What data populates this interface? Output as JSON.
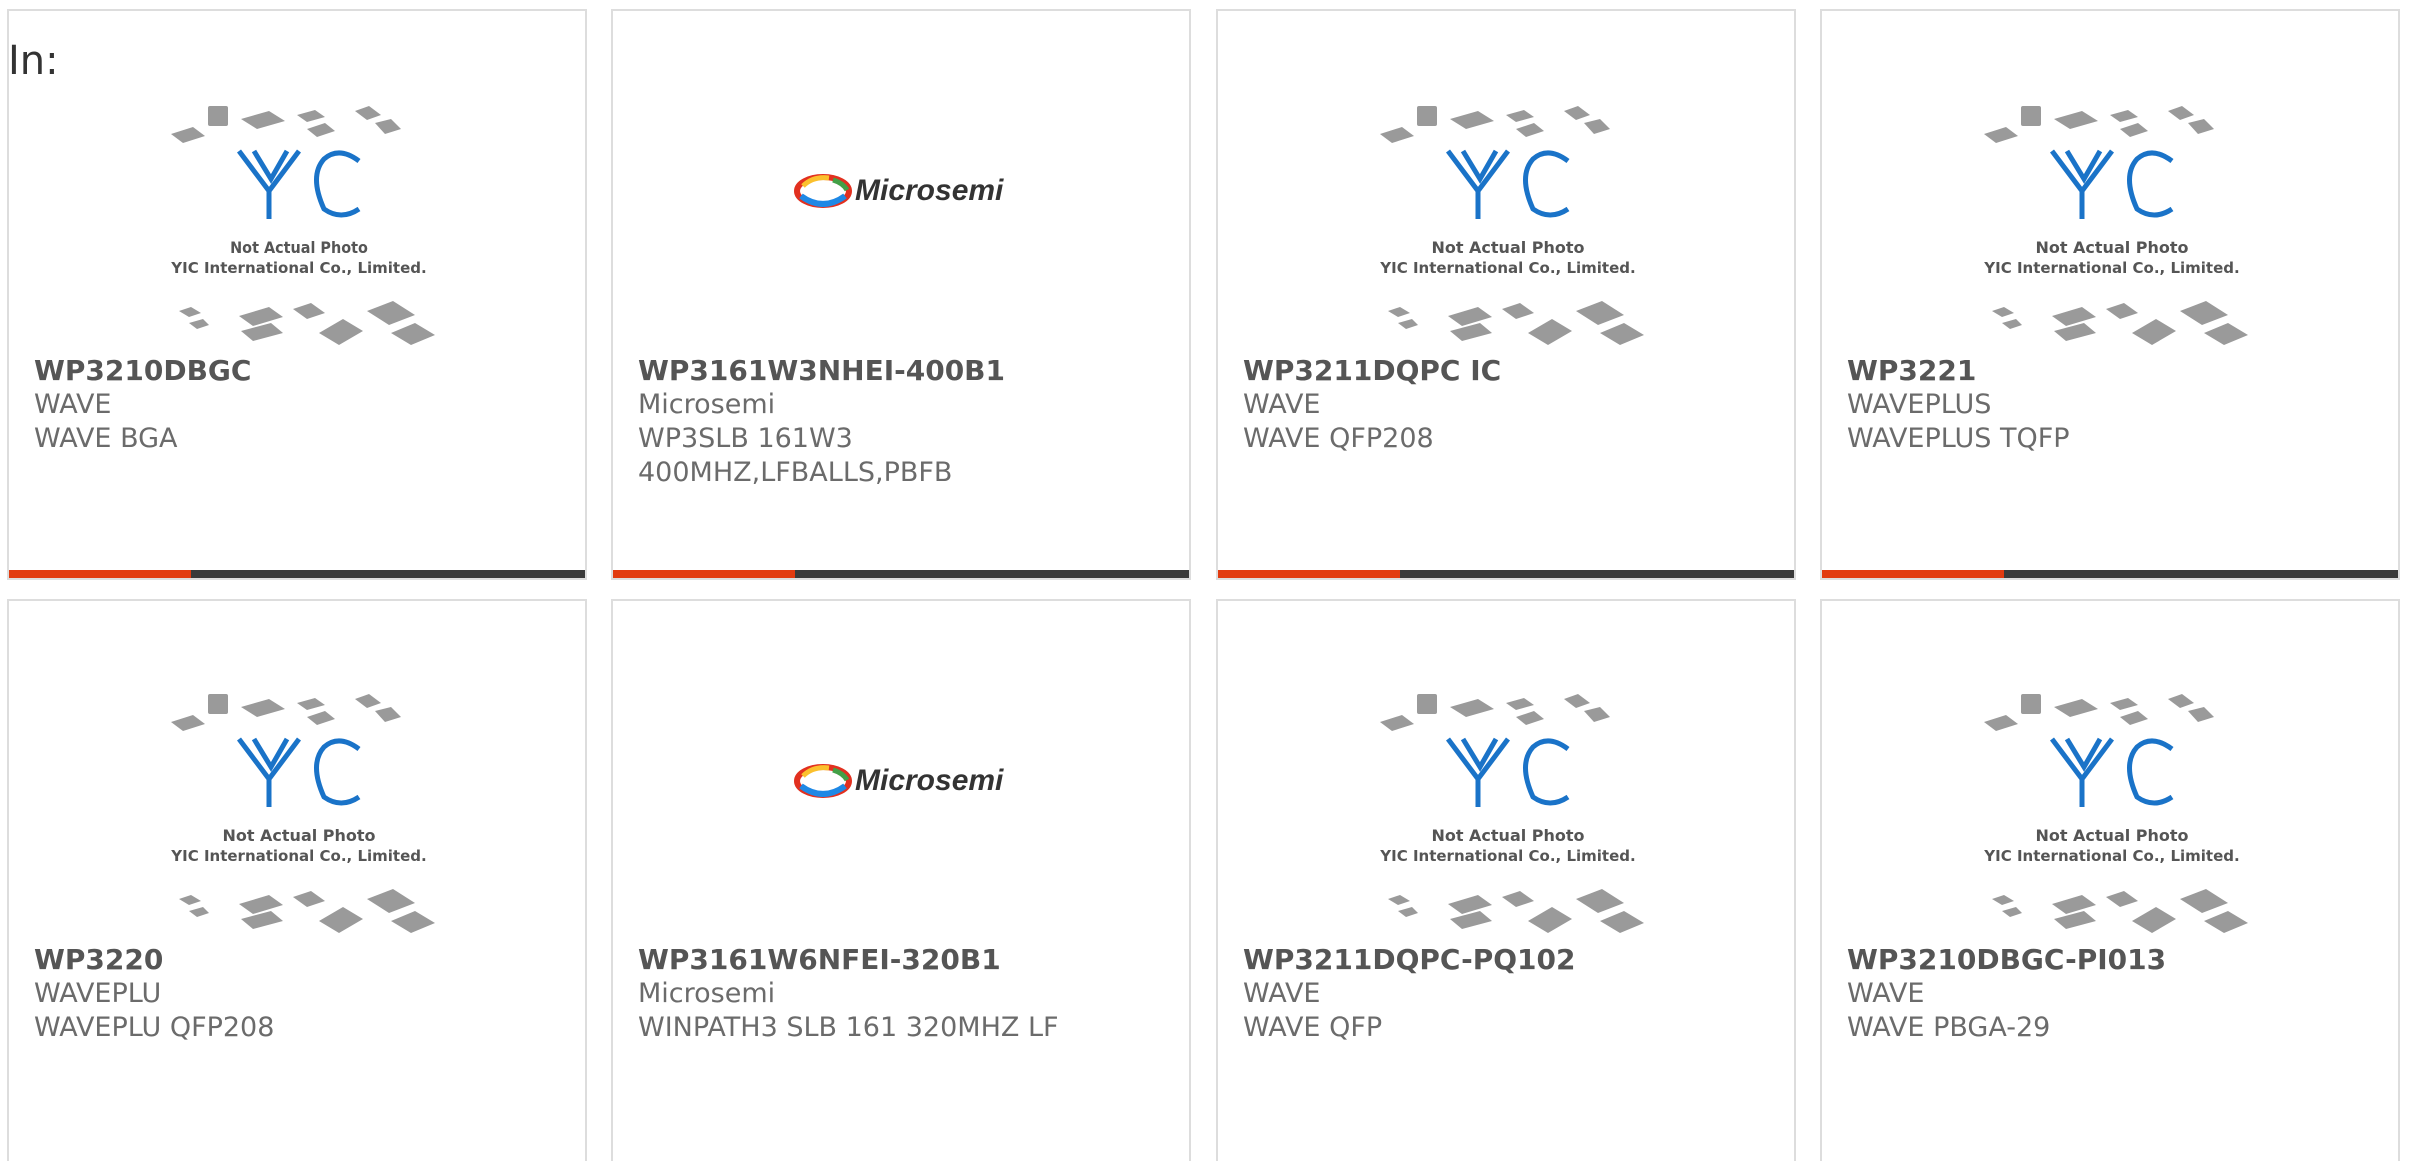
{
  "heading": "In:",
  "colors": {
    "accent": "#e23b10",
    "bar": "#3a3a3a",
    "yic_blue": "#1a73c8"
  },
  "placeholder": {
    "line1": "Not Actual Photo",
    "line2": "YIC International Co., Limited.",
    "logo_text": "YIC"
  },
  "microsemi_logo_text": "Microsemi",
  "products": [
    {
      "part": "WP3210DBGC",
      "brand": "WAVE",
      "desc": "WAVE BGA",
      "desc2": "",
      "image": "yic-placeholder"
    },
    {
      "part": "WP3161W3NHEI-400B1",
      "brand": "Microsemi",
      "desc": "WP3SLB 161W3",
      "desc2": "400MHZ,LFBALLS,PBFB",
      "image": "microsemi-logo"
    },
    {
      "part": "WP3211DQPC IC",
      "brand": "WAVE",
      "desc": "WAVE QFP208",
      "desc2": "",
      "image": "yic-placeholder"
    },
    {
      "part": "WP3221",
      "brand": "WAVEPLUS",
      "desc": "WAVEPLUS TQFP",
      "desc2": "",
      "image": "yic-placeholder"
    },
    {
      "part": "WP3220",
      "brand": "WAVEPLU",
      "desc": "WAVEPLU QFP208",
      "desc2": "",
      "image": "yic-placeholder"
    },
    {
      "part": "WP3161W6NFEI-320B1",
      "brand": "Microsemi",
      "desc": "WINPATH3 SLB 161 320MHZ LF",
      "desc2": "",
      "image": "microsemi-logo"
    },
    {
      "part": "WP3211DQPC-PQ102",
      "brand": "WAVE",
      "desc": "WAVE QFP",
      "desc2": "",
      "image": "yic-placeholder"
    },
    {
      "part": "WP3210DBGC-PI013",
      "brand": "WAVE",
      "desc": "WAVE PBGA-29",
      "desc2": "",
      "image": "yic-placeholder"
    }
  ]
}
